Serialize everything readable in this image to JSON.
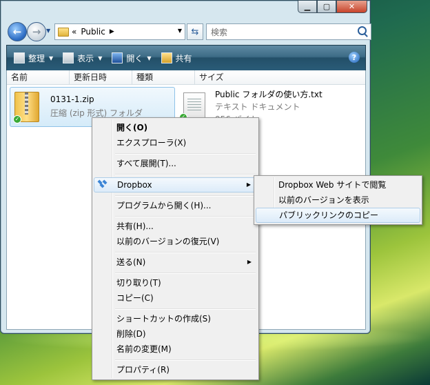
{
  "explorer": {
    "address": {
      "prefix": "«",
      "path": "Public"
    },
    "search_placeholder": "検索",
    "toolbar": {
      "organize": "整理",
      "views": "表示",
      "open": "開く",
      "share": "共有"
    },
    "columns": [
      "名前",
      "更新日時",
      "種類",
      "サイズ"
    ],
    "files": [
      {
        "name": "0131-1.zip",
        "type": "圧縮 (zip 形式) フォルダ"
      },
      {
        "name": "Public フォルダの使い方.txt",
        "type": "テキスト ドキュメント",
        "size": "956 バイト"
      }
    ]
  },
  "context_menu": {
    "items": [
      "開く(O)",
      "エクスプローラ(X)",
      "すべて展開(T)...",
      "Dropbox",
      "プログラムから開く(H)...",
      "共有(H)...",
      "以前のバージョンの復元(V)",
      "送る(N)",
      "切り取り(T)",
      "コピー(C)",
      "ショートカットの作成(S)",
      "削除(D)",
      "名前の変更(M)",
      "プロパティ(R)"
    ]
  },
  "dropbox_submenu": {
    "items": [
      "Dropbox Web サイトで閲覧",
      "以前のバージョンを表示",
      "パブリックリンクのコピー"
    ]
  },
  "icons": {
    "back": "back-arrow-icon",
    "forward": "forward-arrow-icon",
    "folder": "folder-icon",
    "refresh": "refresh-icon",
    "search": "search-icon",
    "help": "help-icon",
    "zip": "zip-folder-icon",
    "text": "text-document-icon",
    "dropbox": "dropbox-icon"
  }
}
